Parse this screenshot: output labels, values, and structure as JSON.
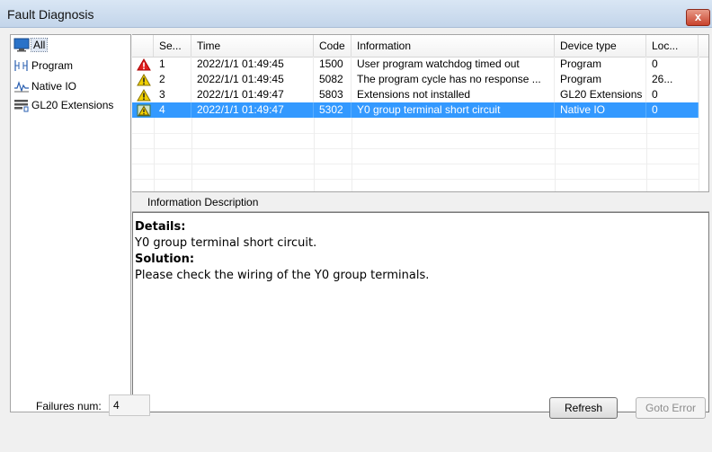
{
  "window": {
    "title": "Fault Diagnosis",
    "close_glyph": "x"
  },
  "tree": {
    "items": [
      {
        "label": "All",
        "icon": "monitor-icon"
      },
      {
        "label": "Program",
        "icon": "ladder-icon"
      },
      {
        "label": "Native IO",
        "icon": "signal-icon"
      },
      {
        "label": "GL20 Extensions",
        "icon": "module-icon"
      }
    ],
    "selected": "All"
  },
  "table": {
    "columns": [
      "Se...",
      "Time",
      "Code",
      "Information",
      "Device type",
      "Loc..."
    ],
    "rows": [
      {
        "icon": "error-icon",
        "seq": "1",
        "time": "2022/1/1 01:49:45",
        "code": "1500",
        "info": "User program watchdog timed out",
        "device": "Program",
        "loc": "0"
      },
      {
        "icon": "warning-icon",
        "seq": "2",
        "time": "2022/1/1 01:49:45",
        "code": "5082",
        "info": "The program cycle has no response ...",
        "device": "Program",
        "loc": "26..."
      },
      {
        "icon": "warning-icon",
        "seq": "3",
        "time": "2022/1/1 01:49:47",
        "code": "5803",
        "info": "Extensions not installed",
        "device": "GL20 Extensions",
        "loc": "0"
      },
      {
        "icon": "info-icon",
        "seq": "4",
        "time": "2022/1/1 01:49:47",
        "code": "5302",
        "info": "Y0 group terminal short circuit",
        "device": "Native IO",
        "loc": "0"
      }
    ],
    "selected_row": "4"
  },
  "description": {
    "tab_label": "Information Description",
    "details_label": "Details:",
    "details_text": "Y0 group terminal short circuit.",
    "solution_label": "Solution:",
    "solution_text": "Please check the wiring of the Y0 group terminals."
  },
  "footer": {
    "failures_label": "Failures num:",
    "failures_value": "4",
    "refresh_label": "Refresh",
    "goto_label": "Goto Error"
  },
  "colors": {
    "selection": "#3399ff",
    "error": "#e02020",
    "warning": "#f0d000"
  }
}
